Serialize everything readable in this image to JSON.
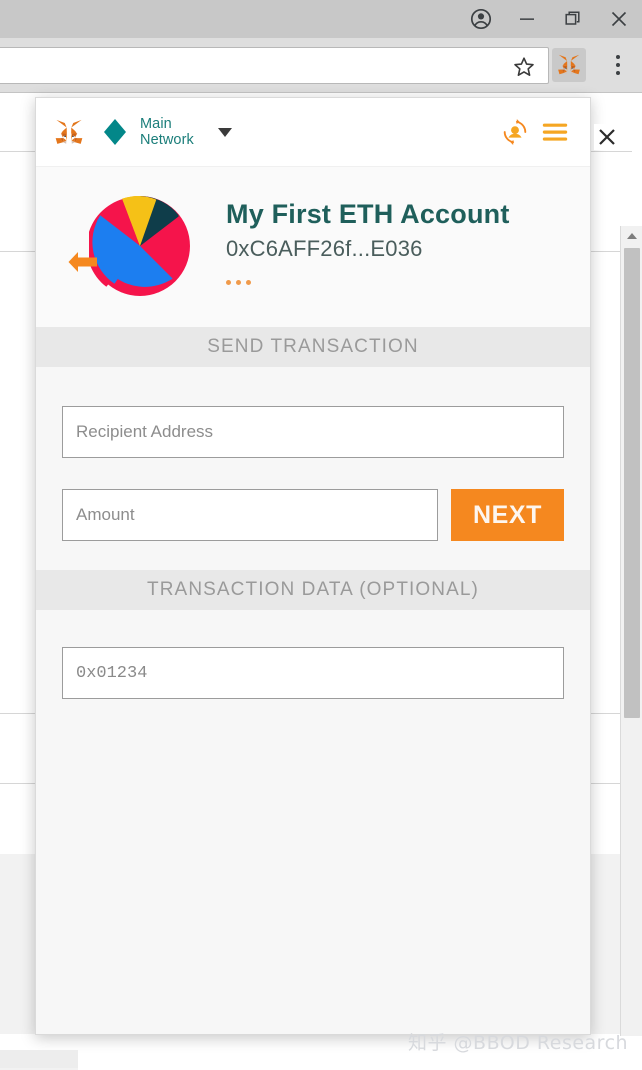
{
  "window": {
    "controls": [
      {
        "name": "profile-avatar-button",
        "icon": "person-circle-icon",
        "label": "Profile"
      },
      {
        "name": "minimize-button",
        "icon": "minimize-icon",
        "label": "Minimize"
      },
      {
        "name": "restore-button",
        "icon": "restore-icon",
        "label": "Restore"
      },
      {
        "name": "close-button",
        "icon": "close-icon",
        "label": "Close"
      }
    ]
  },
  "browser": {
    "omnibox_value": "",
    "omnibox_placeholder": "",
    "bookmark_icon": "star-icon",
    "extension_icon": "metamask-fox-icon",
    "menu_icon": "kebab-menu-icon"
  },
  "popup": {
    "close_label": "✕",
    "header": {
      "logo_icon": "metamask-fox-icon",
      "network_icon": "ethereum-diamond-icon",
      "network_name": "Main\nNetwork",
      "network_line1": "Main",
      "network_line2": "Network",
      "caret_icon": "chevron-down-icon",
      "accounts_icon": "account-switch-icon",
      "menu_icon": "hamburger-menu-icon"
    },
    "account": {
      "back_icon": "back-arrow-icon",
      "identicon": "pie-chart-identicon",
      "name": "My First ETH Account",
      "address": "0xC6AFF26f...E036",
      "more_icon": "ellipsis-icon"
    },
    "send_section": {
      "title": "SEND TRANSACTION",
      "recipient_placeholder": "Recipient Address",
      "recipient_value": "",
      "amount_placeholder": "Amount",
      "amount_value": "",
      "next_label": "NEXT"
    },
    "data_section": {
      "title": "TRANSACTION DATA (OPTIONAL)",
      "data_placeholder": "0x01234",
      "data_value": ""
    }
  },
  "watermark": {
    "text": "知乎 @BBOD Research"
  },
  "colors": {
    "accent_orange": "#f5881f",
    "teal": "#1b7e7a",
    "account_name": "#1f5f5b",
    "banner_bg": "#e8e8e8",
    "identicon_red": "#f5144b",
    "identicon_blue": "#1c7ef0",
    "identicon_yellow": "#f5c117",
    "identicon_teal": "#0f3d4a"
  },
  "chart_data": {
    "type": "pie",
    "title": "Account identicon",
    "categories": [
      "red",
      "blue",
      "yellow",
      "dark-teal"
    ],
    "values": [
      45,
      36,
      11,
      8
    ],
    "colors": [
      "#f5144b",
      "#1c7ef0",
      "#f5c117",
      "#0f3d4a"
    ],
    "xlabel": "",
    "ylabel": "",
    "legend": "none"
  }
}
